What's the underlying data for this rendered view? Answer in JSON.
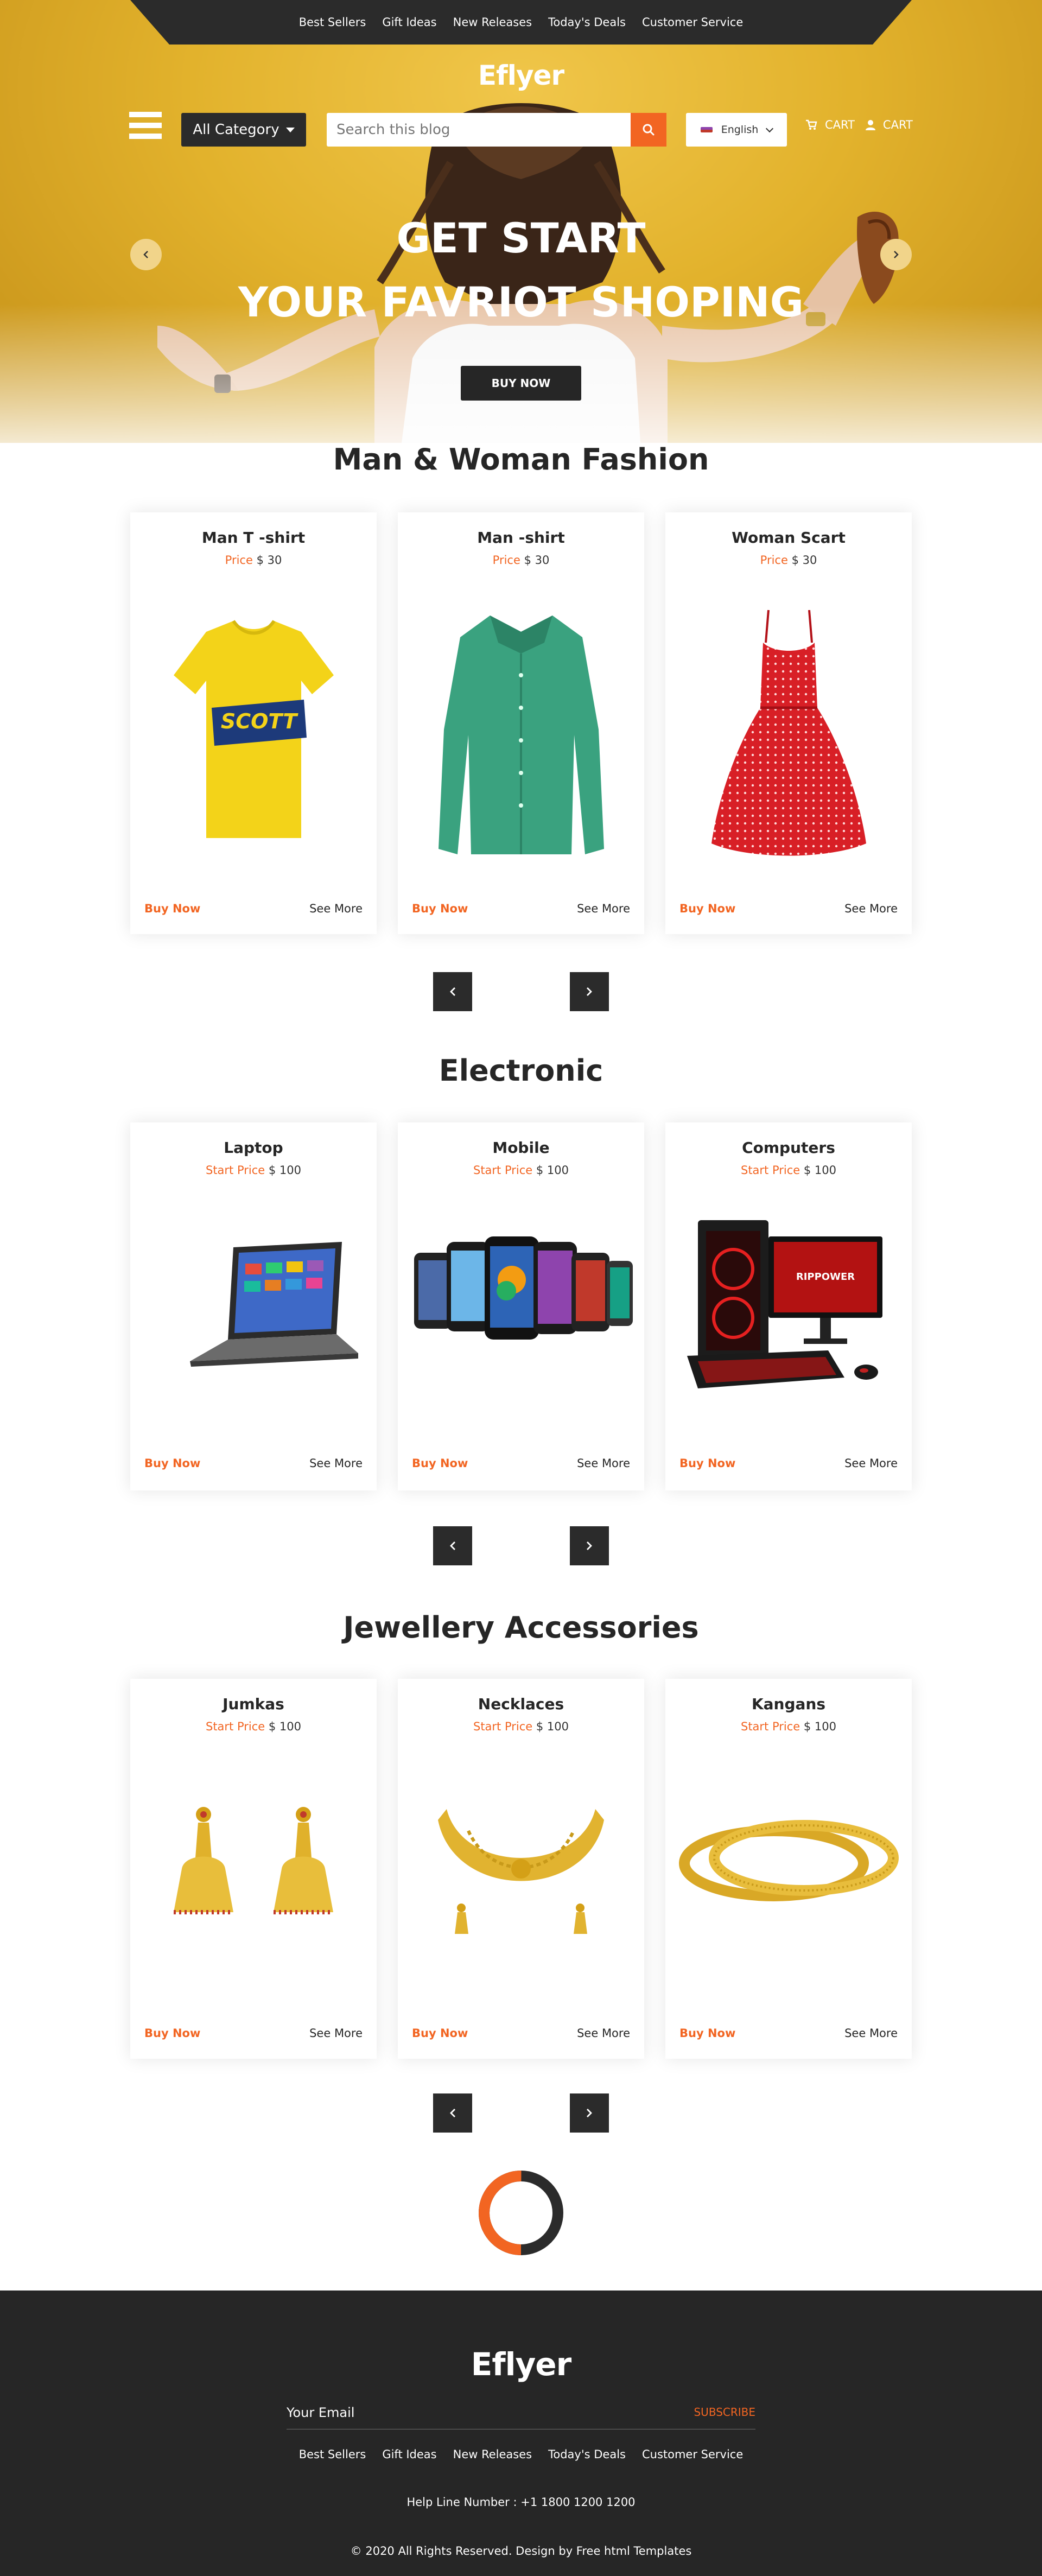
{
  "nav": {
    "links": [
      "Best Sellers",
      "Gift Ideas",
      "New Releases",
      "Today's Deals",
      "Customer Service"
    ]
  },
  "brand": {
    "logo": "Eflyer"
  },
  "header": {
    "category_label": "All Category",
    "search_placeholder": "Search this blog",
    "language": "English",
    "cart_label": "CART",
    "account_label": "CART"
  },
  "hero": {
    "line1": "GET START",
    "line2": "YOUR FAVRIOT SHOPING",
    "button": "BUY NOW"
  },
  "sections": [
    {
      "title": "Man & Woman Fashion",
      "products": [
        {
          "name": "Man T -shirt",
          "price_label": "Price",
          "price": "$ 30",
          "buy": "Buy Now",
          "more": "See More",
          "image": "yellow-tshirt"
        },
        {
          "name": "Man -shirt",
          "price_label": "Price",
          "price": "$ 30",
          "buy": "Buy Now",
          "more": "See More",
          "image": "green-shirt"
        },
        {
          "name": "Woman Scart",
          "price_label": "Price",
          "price": "$ 30",
          "buy": "Buy Now",
          "more": "See More",
          "image": "red-dress"
        }
      ]
    },
    {
      "title": "Electronic",
      "products": [
        {
          "name": "Laptop",
          "price_label": "Start Price",
          "price": "$ 100",
          "buy": "Buy Now",
          "more": "See More",
          "image": "laptop"
        },
        {
          "name": "Mobile",
          "price_label": "Start Price",
          "price": "$ 100",
          "buy": "Buy Now",
          "more": "See More",
          "image": "smartphones"
        },
        {
          "name": "Computers",
          "price_label": "Start Price",
          "price": "$ 100",
          "buy": "Buy Now",
          "more": "See More",
          "image": "desktop-computer"
        }
      ]
    },
    {
      "title": "Jewellery Accessories",
      "products": [
        {
          "name": "Jumkas",
          "price_label": "Start Price",
          "price": "$ 100",
          "buy": "Buy Now",
          "more": "See More",
          "image": "gold-earrings"
        },
        {
          "name": "Necklaces",
          "price_label": "Start Price",
          "price": "$ 100",
          "buy": "Buy Now",
          "more": "See More",
          "image": "gold-necklace"
        },
        {
          "name": "Kangans",
          "price_label": "Start Price",
          "price": "$ 100",
          "buy": "Buy Now",
          "more": "See More",
          "image": "gold-bangles"
        }
      ]
    }
  ],
  "footer": {
    "logo": "Eflyer",
    "email_placeholder": "Your Email",
    "subscribe": "SUBSCRIBE",
    "links": [
      "Best Sellers",
      "Gift Ideas",
      "New Releases",
      "Today's Deals",
      "Customer Service"
    ],
    "helpline": "Help Line Number : +1 1800 1200 1200",
    "copyright": "© 2020 All Rights Reserved. Design by Free html Templates"
  },
  "colors": {
    "accent": "#f26522",
    "dark": "#262626",
    "hero": "#e2b22c"
  }
}
